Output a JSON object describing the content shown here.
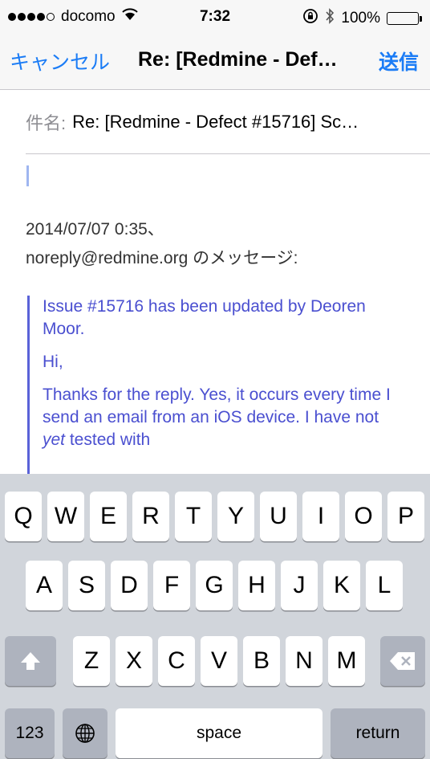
{
  "status_bar": {
    "carrier": "docomo",
    "time": "7:32",
    "battery": "100%"
  },
  "nav": {
    "cancel": "キャンセル",
    "title": "Re: [Redmine - Def…",
    "send": "送信"
  },
  "subject": {
    "label": "件名:",
    "value": "Re: [Redmine - Defect #15716] Sc…"
  },
  "body": {
    "date_line": "2014/07/07 0:35、",
    "from_line": "noreply@redmine.org のメッセージ:",
    "quote_line1": "Issue #15716 has been updated by Deoren Moor.",
    "quote_line2": "Hi,",
    "quote_line3_a": "Thanks for the reply. Yes, it occurs every time I send an email from an iOS device. I have not ",
    "quote_line3_em": "yet",
    "quote_line3_b": " tested with"
  },
  "keyboard": {
    "row1": [
      "Q",
      "W",
      "E",
      "R",
      "T",
      "Y",
      "U",
      "I",
      "O",
      "P"
    ],
    "row2": [
      "A",
      "S",
      "D",
      "F",
      "G",
      "H",
      "J",
      "K",
      "L"
    ],
    "row3": [
      "Z",
      "X",
      "C",
      "V",
      "B",
      "N",
      "M"
    ],
    "numbers_key": "123",
    "space_key": "space",
    "return_key": "return"
  },
  "colors": {
    "accent": "#1b7cf6",
    "quote": "#4a4fd0",
    "keyboard_bg": "#d1d5db"
  }
}
